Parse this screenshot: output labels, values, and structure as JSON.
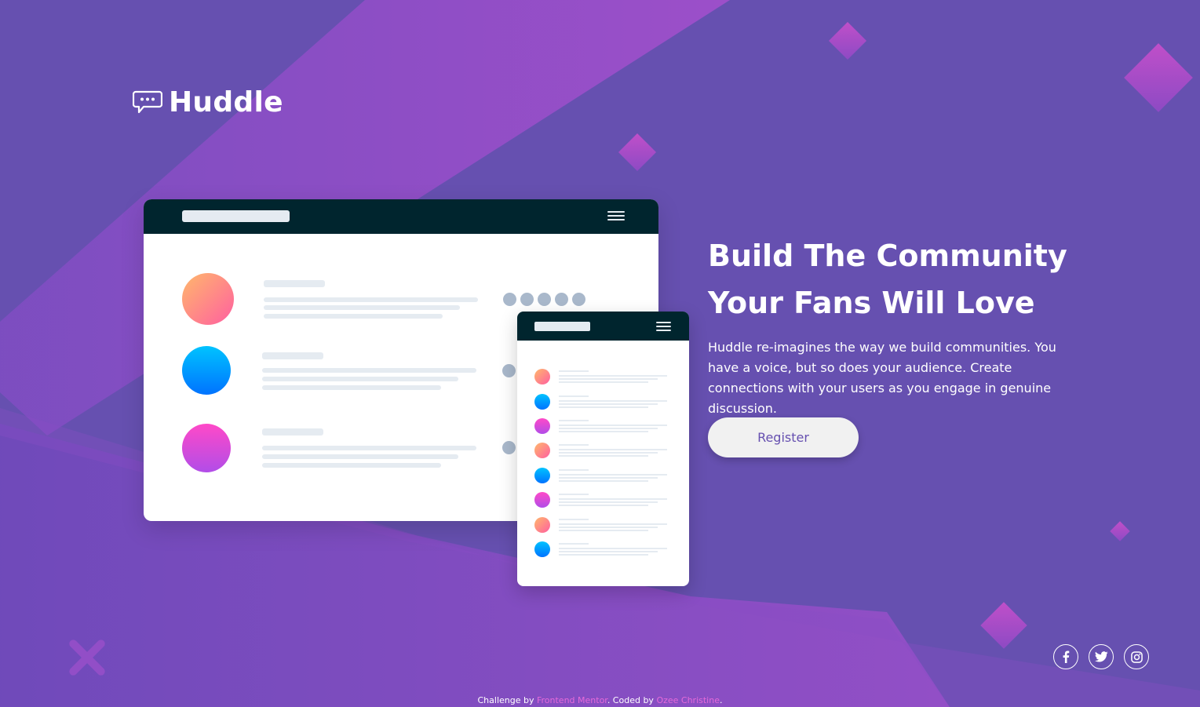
{
  "brand": {
    "name": "Huddle",
    "logo_icon": "chat-bubble-icon"
  },
  "hero": {
    "headline": "Build The Community Your Fans Will Love",
    "description": "Huddle re-imagines the way we build communities. You have a voice, but so does your audience. Create connections with your users as you engage in genuine discussion.",
    "cta_label": "Register"
  },
  "social": {
    "icons": [
      "facebook-icon",
      "twitter-icon",
      "instagram-icon"
    ]
  },
  "footer": {
    "prefix": "Challenge by ",
    "link1": "Frontend Mentor",
    "middle": ". Coded by ",
    "link2": "Ozee Christine",
    "suffix": "."
  },
  "colors": {
    "background": "#6650b0",
    "accent": "#e66ad9",
    "cta_text": "#6650b0",
    "mockup_bar": "#00252e"
  }
}
